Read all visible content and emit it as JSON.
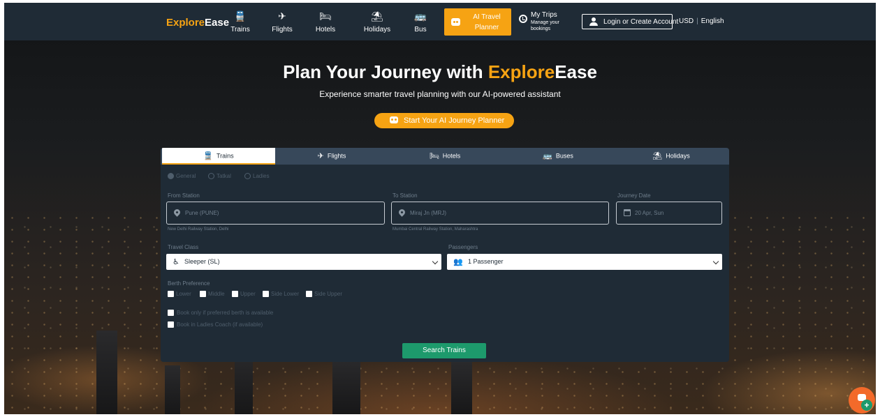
{
  "header": {
    "logo_part1": "Explore",
    "logo_part2": "Ease",
    "nav": [
      {
        "label": "Trains",
        "icon": "train-icon"
      },
      {
        "label": "Flights",
        "icon": "plane-icon"
      },
      {
        "label": "Hotels",
        "icon": "bed-icon"
      },
      {
        "label": "Holidays",
        "icon": "umbrella-icon"
      },
      {
        "label": "Bus",
        "icon": "bus-icon"
      }
    ],
    "ai_planner": "AI Travel Planner",
    "my_trips_title": "My Trips",
    "my_trips_sub": "Manage your bookings",
    "login": "Login or Create Account",
    "currency": "USD",
    "language": "English"
  },
  "hero": {
    "title_part1": "Plan Your Journey with ",
    "title_highlight": "Explore",
    "title_part3": "Ease",
    "subtitle": "Experience smarter travel planning with our AI-powered assistant",
    "cta": "Start Your AI Journey Planner"
  },
  "search": {
    "tabs": [
      {
        "label": "Trains",
        "icon": "train-icon"
      },
      {
        "label": "Flights",
        "icon": "plane-icon"
      },
      {
        "label": "Hotels",
        "icon": "bed-icon"
      },
      {
        "label": "Buses",
        "icon": "bus-icon"
      },
      {
        "label": "Holidays",
        "icon": "umbrella-icon"
      }
    ],
    "quota": [
      "General",
      "Tatkal",
      "Ladies"
    ],
    "from_label": "From Station",
    "from_value": "Pune (PUNE)",
    "from_hint": "New Delhi Railway Station, Delhi",
    "to_label": "To Station",
    "to_value": "Miraj Jn (MRJ)",
    "to_hint": "Mumbai Central Railway Station, Maharashtra",
    "date_label": "Journey Date",
    "date_value": "20 Apr, Sun",
    "class_label": "Travel Class",
    "class_value": "Sleeper (SL)",
    "passengers_label": "Passengers",
    "passengers_value": "1 Passenger",
    "berth_label": "Berth Preference",
    "berths": [
      "Lower",
      "Middle",
      "Upper",
      "Side Lower",
      "Side Upper"
    ],
    "opt1": "Book only if preferred berth is available",
    "opt2": "Book in Ladies Coach (if available)",
    "submit": "Search Trains"
  },
  "colors": {
    "accent": "#f6a313",
    "header_bg": "#1f2b36",
    "panel_bg": "#1f2b36",
    "search_button": "#1d9a6c"
  }
}
